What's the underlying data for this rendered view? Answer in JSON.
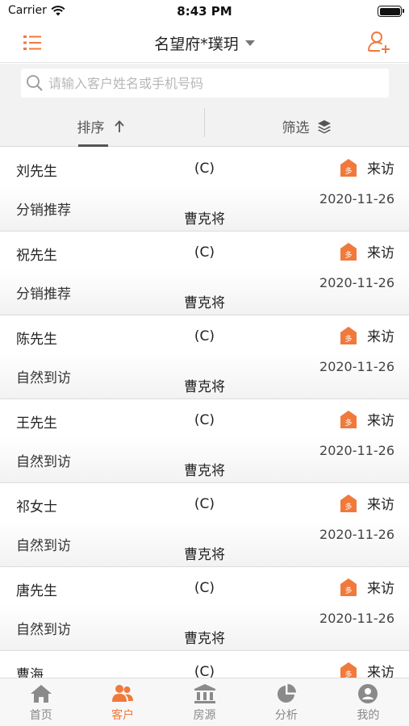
{
  "status_bar": {
    "carrier": "Carrier",
    "time": "8:43 PM"
  },
  "header": {
    "title": "名望府*璞玥"
  },
  "search": {
    "placeholder": "请输入客户姓名或手机号码"
  },
  "tabs": [
    {
      "label": "排序"
    },
    {
      "label": "筛选"
    }
  ],
  "customers": [
    {
      "name": "刘先生",
      "level": "(C)",
      "status": "来访",
      "source": "分销推荐",
      "date": "2020-11-26",
      "agent": "曹克将"
    },
    {
      "name": "祝先生",
      "level": "(C)",
      "status": "来访",
      "source": "分销推荐",
      "date": "2020-11-26",
      "agent": "曹克将"
    },
    {
      "name": "陈先生",
      "level": "(C)",
      "status": "来访",
      "source": "自然到访",
      "date": "2020-11-26",
      "agent": "曹克将"
    },
    {
      "name": "王先生",
      "level": "(C)",
      "status": "来访",
      "source": "自然到访",
      "date": "2020-11-26",
      "agent": "曹克将"
    },
    {
      "name": "祁女士",
      "level": "(C)",
      "status": "来访",
      "source": "自然到访",
      "date": "2020-11-26",
      "agent": "曹克将"
    },
    {
      "name": "唐先生",
      "level": "(C)",
      "status": "来访",
      "source": "自然到访",
      "date": "2020-11-26",
      "agent": "曹克将"
    },
    {
      "name": "曹海",
      "level": "(C)",
      "status": "来访",
      "source": "",
      "date": "",
      "agent": ""
    }
  ],
  "tabbar": [
    {
      "label": "首页",
      "icon": "home-icon"
    },
    {
      "label": "客户",
      "icon": "customers-icon",
      "active": true
    },
    {
      "label": "房源",
      "icon": "building-icon"
    },
    {
      "label": "分析",
      "icon": "pie-chart-icon"
    },
    {
      "label": "我的",
      "icon": "profile-icon"
    }
  ],
  "colors": {
    "accent": "#f07a3c",
    "inactive": "#888888",
    "background": "#f2f2f2"
  }
}
